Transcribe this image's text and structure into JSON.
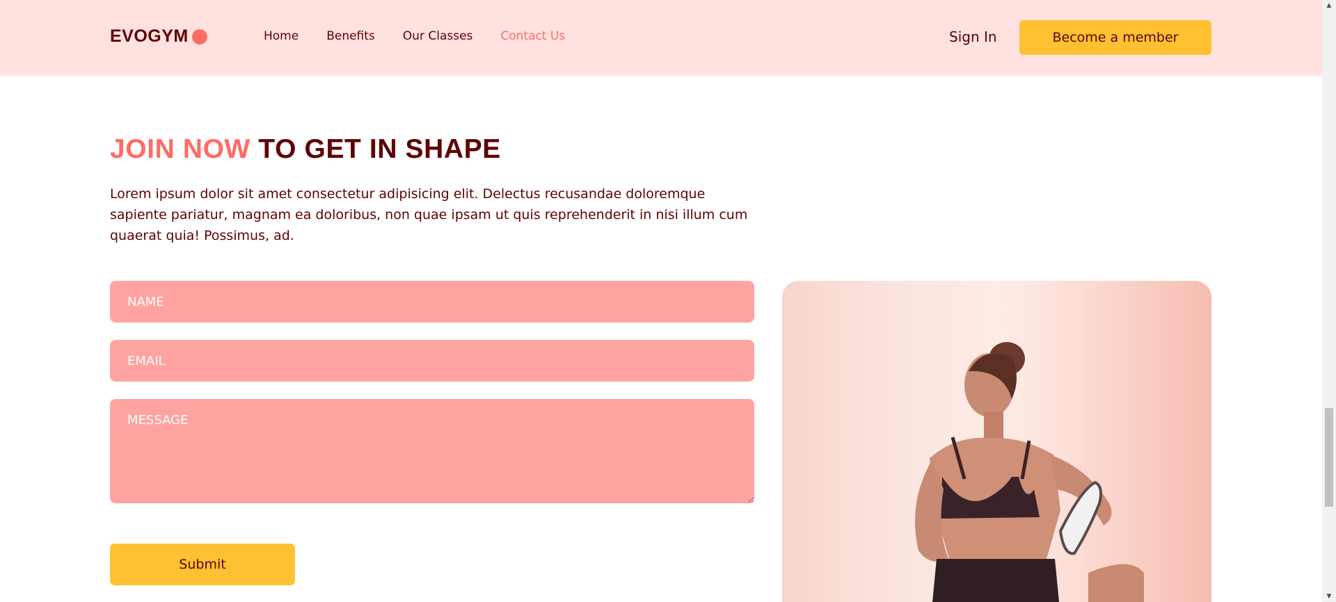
{
  "nav": {
    "logo": "EVOGYM",
    "links": [
      "Home",
      "Benefits",
      "Our Classes",
      "Contact Us"
    ],
    "active": "Contact Us",
    "sign_in": "Sign In",
    "cta": "Become a member"
  },
  "contact": {
    "heading_accent": "JOIN NOW",
    "heading_rest": " TO GET IN SHAPE",
    "intro": "Lorem ipsum dolor sit amet consectetur adipisicing elit. Delectus recusandae doloremque sapiente pariatur, magnam ea doloribus, non quae ipsam ut quis reprehenderit in nisi illum cum quaerat quia! Possimus, ad.",
    "form": {
      "name_placeholder": "NAME",
      "email_placeholder": "EMAIL",
      "message_placeholder": "MESSAGE",
      "submit": "Submit"
    }
  },
  "colors": {
    "primary": "#ff6b66",
    "secondary": "#ffc132",
    "dark": "#5e0000",
    "field_bg": "#ffa3a0",
    "nav_bg": "#ffe1e0"
  },
  "icons": {
    "scroll_up": "triangle-up",
    "scroll_down": "triangle-down"
  }
}
